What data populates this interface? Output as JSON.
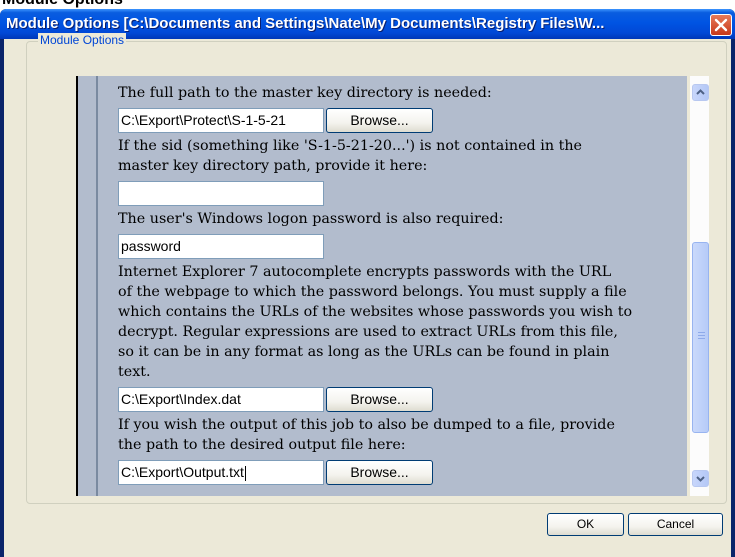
{
  "background_window": {
    "title": "Module Options"
  },
  "window": {
    "title": "Module Options [C:\\Documents and Settings\\Nate\\My Documents\\Registry Files\\W...",
    "close_icon": "close-icon"
  },
  "group": {
    "label": "Module Options"
  },
  "form": {
    "master_key_label": "The full path to the master key directory is needed:",
    "master_key_value": "C:\\Export\\Protect\\S-1-5-21",
    "sid_label_line1": "If the sid (something like 'S-1-5-21-20...') is not contained in the",
    "sid_label_line2": "master key directory path, provide it here:",
    "sid_value": "",
    "password_label": "The user's Windows logon password is also required:",
    "password_value": "password",
    "urls_label_lines": [
      "Internet Explorer 7 autocomplete encrypts passwords with the URL",
      "of the webpage to which the password belongs. You must supply a file",
      "which contains the URLs of the websites whose passwords you wish to",
      "decrypt. Regular expressions are used to extract URLs from this file,",
      "so it can be in any format as long as the URLs can be found in plain",
      "text."
    ],
    "urls_value": "C:\\Export\\Index.dat",
    "output_label_line1": "If you wish the output of this job to also be dumped to a file, provide",
    "output_label_line2": "the path to the desired output file here:",
    "output_value": "C:\\Export\\Output.txt",
    "browse_label": "Browse..."
  },
  "buttons": {
    "ok": "OK",
    "cancel": "Cancel"
  },
  "colors": {
    "titlebar": "#0054e3",
    "panel": "#b2bccd",
    "dialog": "#ece9d8",
    "group_label": "#0046d5"
  }
}
